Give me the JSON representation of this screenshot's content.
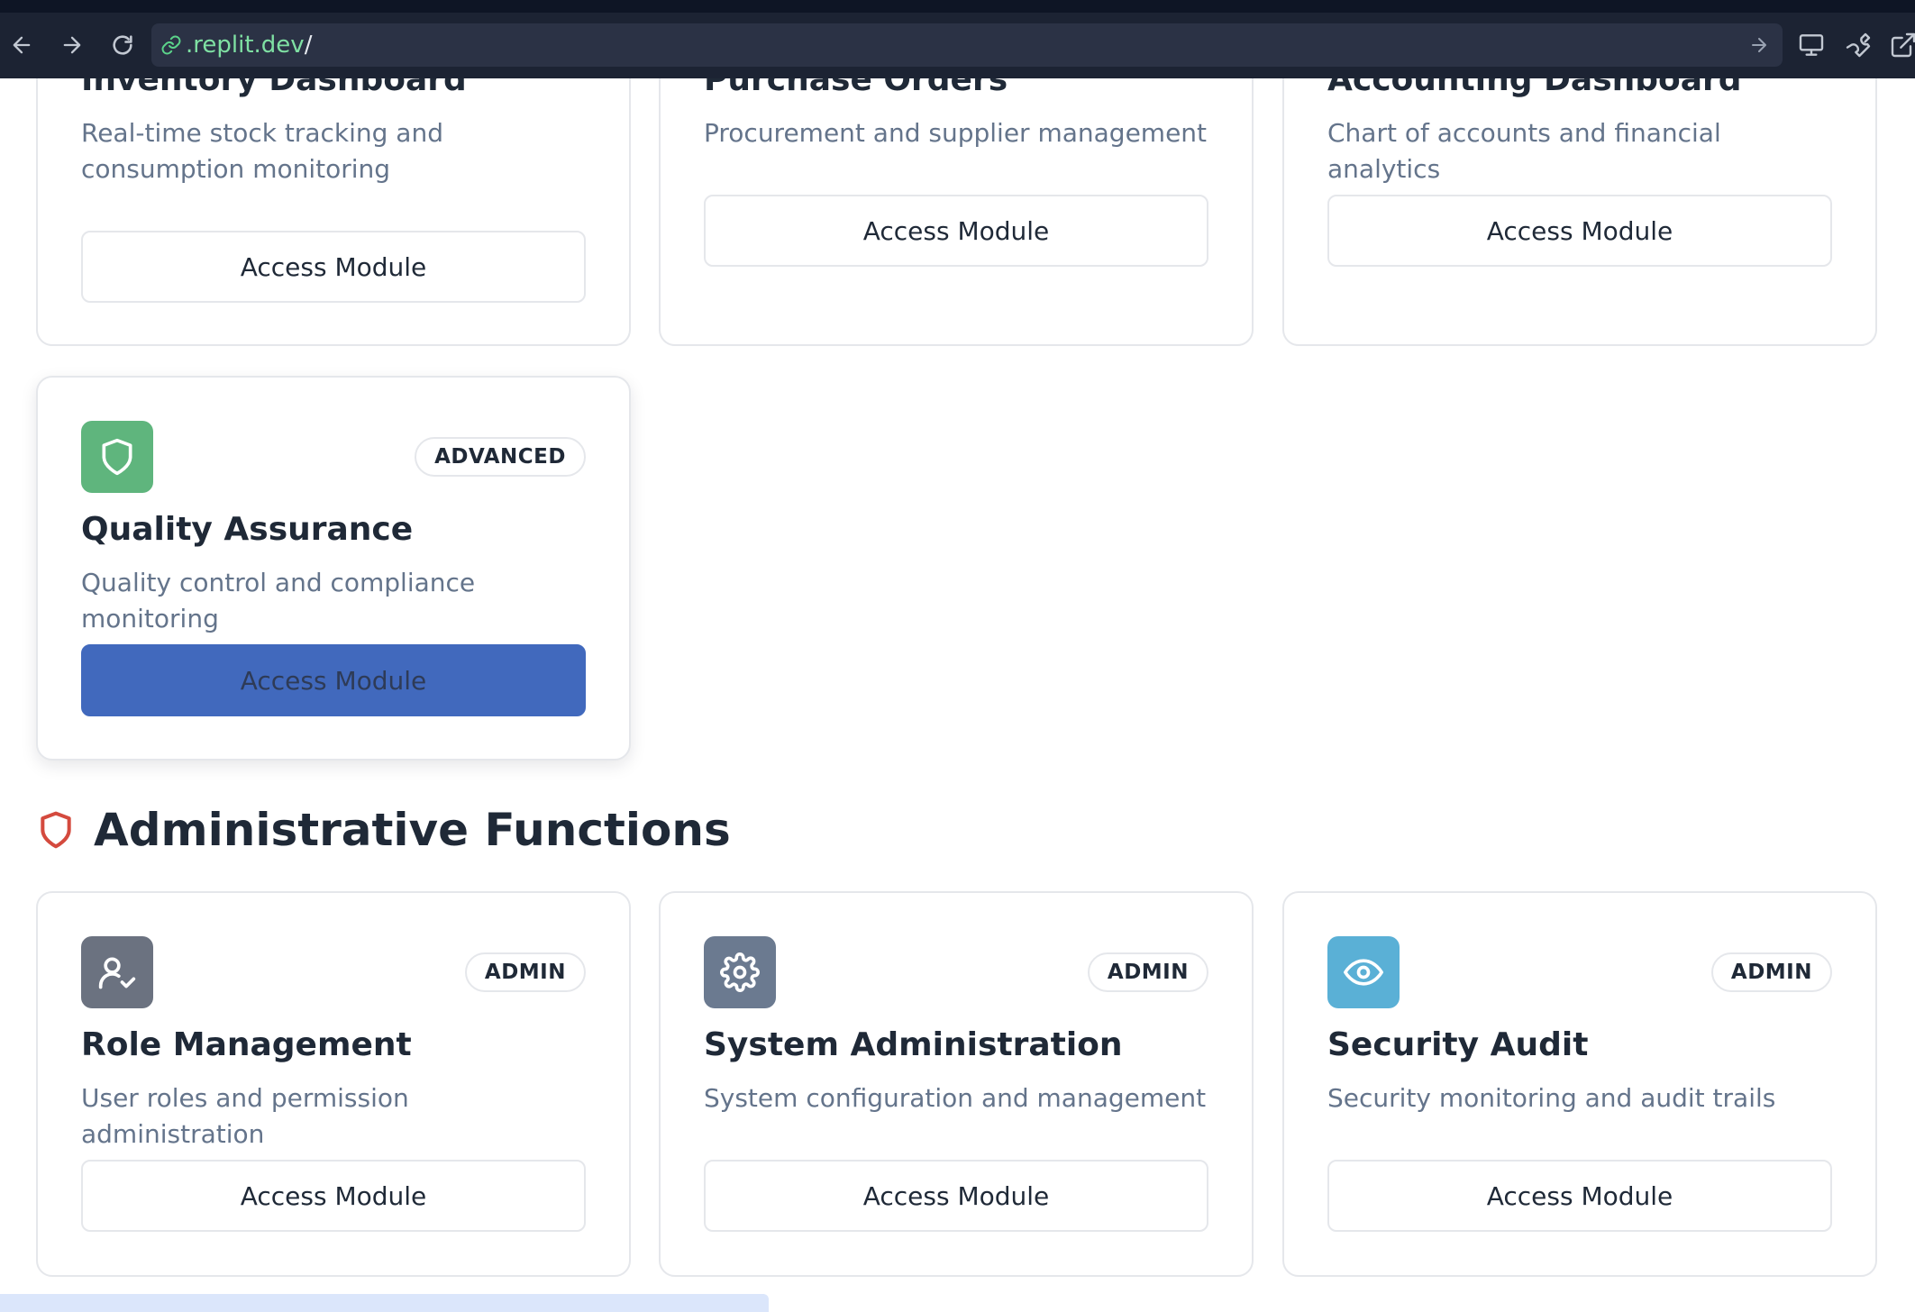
{
  "browser": {
    "url_host": ".replit.dev",
    "url_path": "/"
  },
  "top_cards": [
    {
      "title": "Inventory Dashboard",
      "description": "Real-time stock tracking and consumption monitoring",
      "button_label": "Access Module"
    },
    {
      "title": "Purchase Orders",
      "description": "Procurement and supplier management",
      "button_label": "Access Module"
    },
    {
      "title": "Accounting Dashboard",
      "description": "Chart of accounts and financial analytics",
      "button_label": "Access Module"
    }
  ],
  "qa_card": {
    "badge": "ADVANCED",
    "title": "Quality Assurance",
    "description": "Quality control and compliance monitoring",
    "button_label": "Access Module",
    "icon": "shield-icon",
    "icon_color": "#5fb57d",
    "button_color": "#4169bd"
  },
  "admin_section": {
    "heading": "Administrative Functions",
    "icon": "shield-icon",
    "icon_color": "#d44a3e",
    "cards": [
      {
        "badge": "ADMIN",
        "title": "Role Management",
        "description": "User roles and permission administration",
        "button_label": "Access Module",
        "icon": "user-check-icon",
        "icon_color": "#6b7280"
      },
      {
        "badge": "ADMIN",
        "title": "System Administration",
        "description": "System configuration and management",
        "button_label": "Access Module",
        "icon": "settings-icon",
        "icon_color": "#6b7a90"
      },
      {
        "badge": "ADMIN",
        "title": "Security Audit",
        "description": "Security monitoring and audit trails",
        "button_label": "Access Module",
        "icon": "eye-icon",
        "icon_color": "#5ab0d6"
      }
    ]
  }
}
